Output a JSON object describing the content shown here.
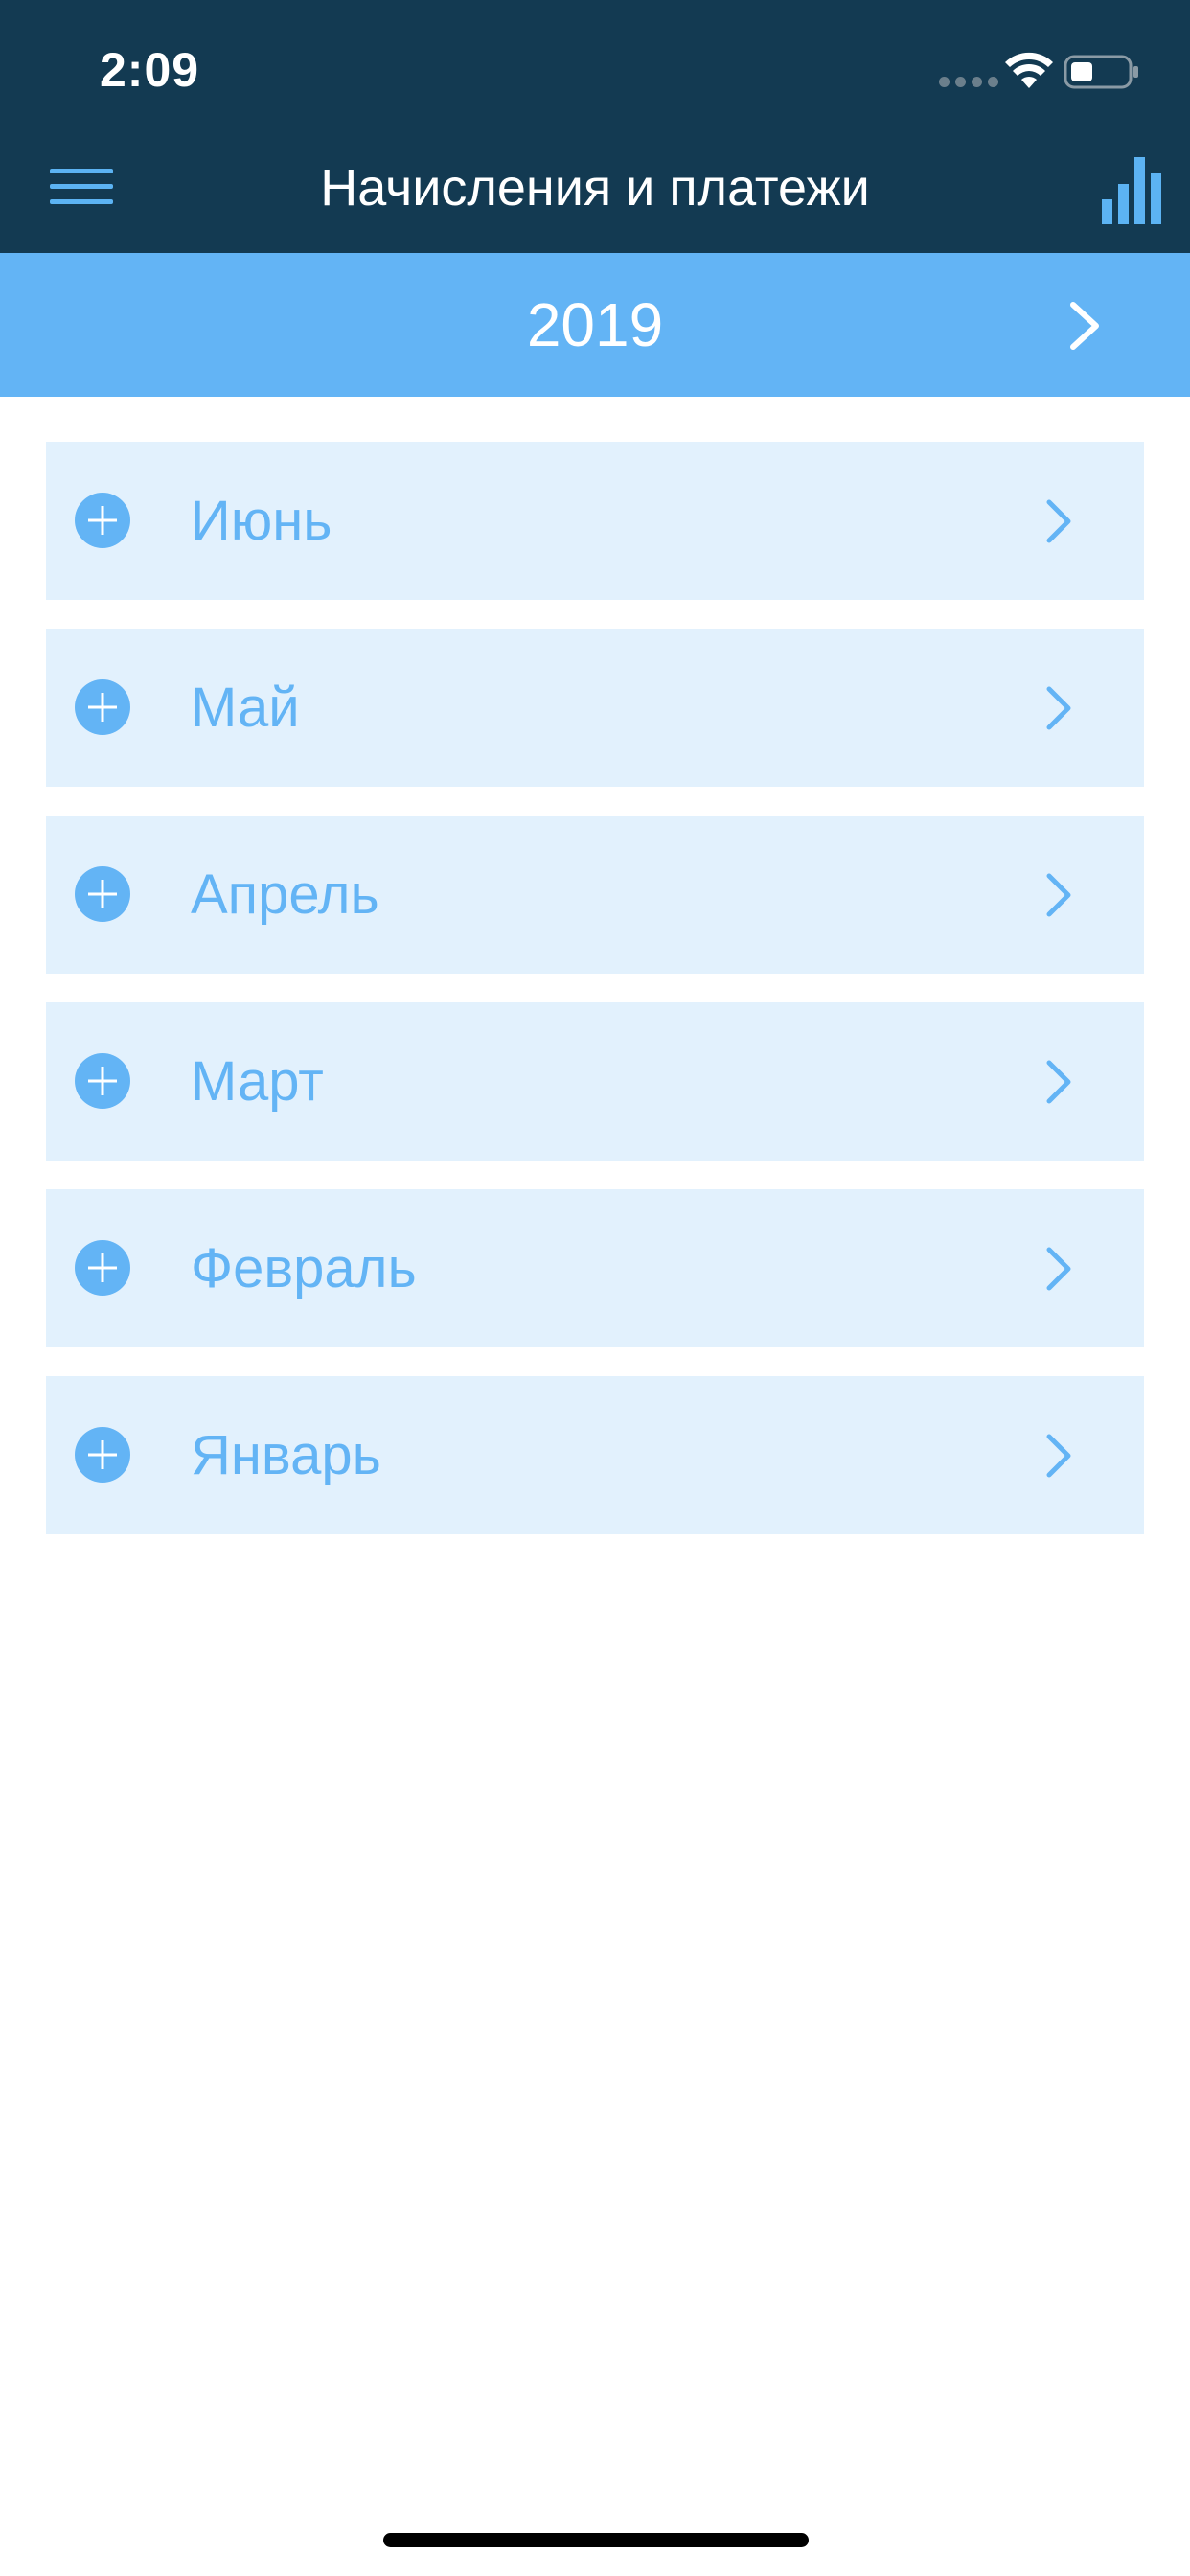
{
  "status_bar": {
    "time": "2:09"
  },
  "nav": {
    "title": "Начисления и платежи",
    "menu_icon": "hamburger-menu-icon",
    "chart_icon": "bar-chart-icon"
  },
  "year_selector": {
    "year": "2019",
    "next_icon": "chevron-right-icon"
  },
  "months": [
    {
      "label": "Июнь"
    },
    {
      "label": "Май"
    },
    {
      "label": "Апрель"
    },
    {
      "label": "Март"
    },
    {
      "label": "Февраль"
    },
    {
      "label": "Январь"
    }
  ],
  "colors": {
    "header_bg": "#133a52",
    "accent": "#63b4f5",
    "row_bg": "#e2f1fd"
  }
}
